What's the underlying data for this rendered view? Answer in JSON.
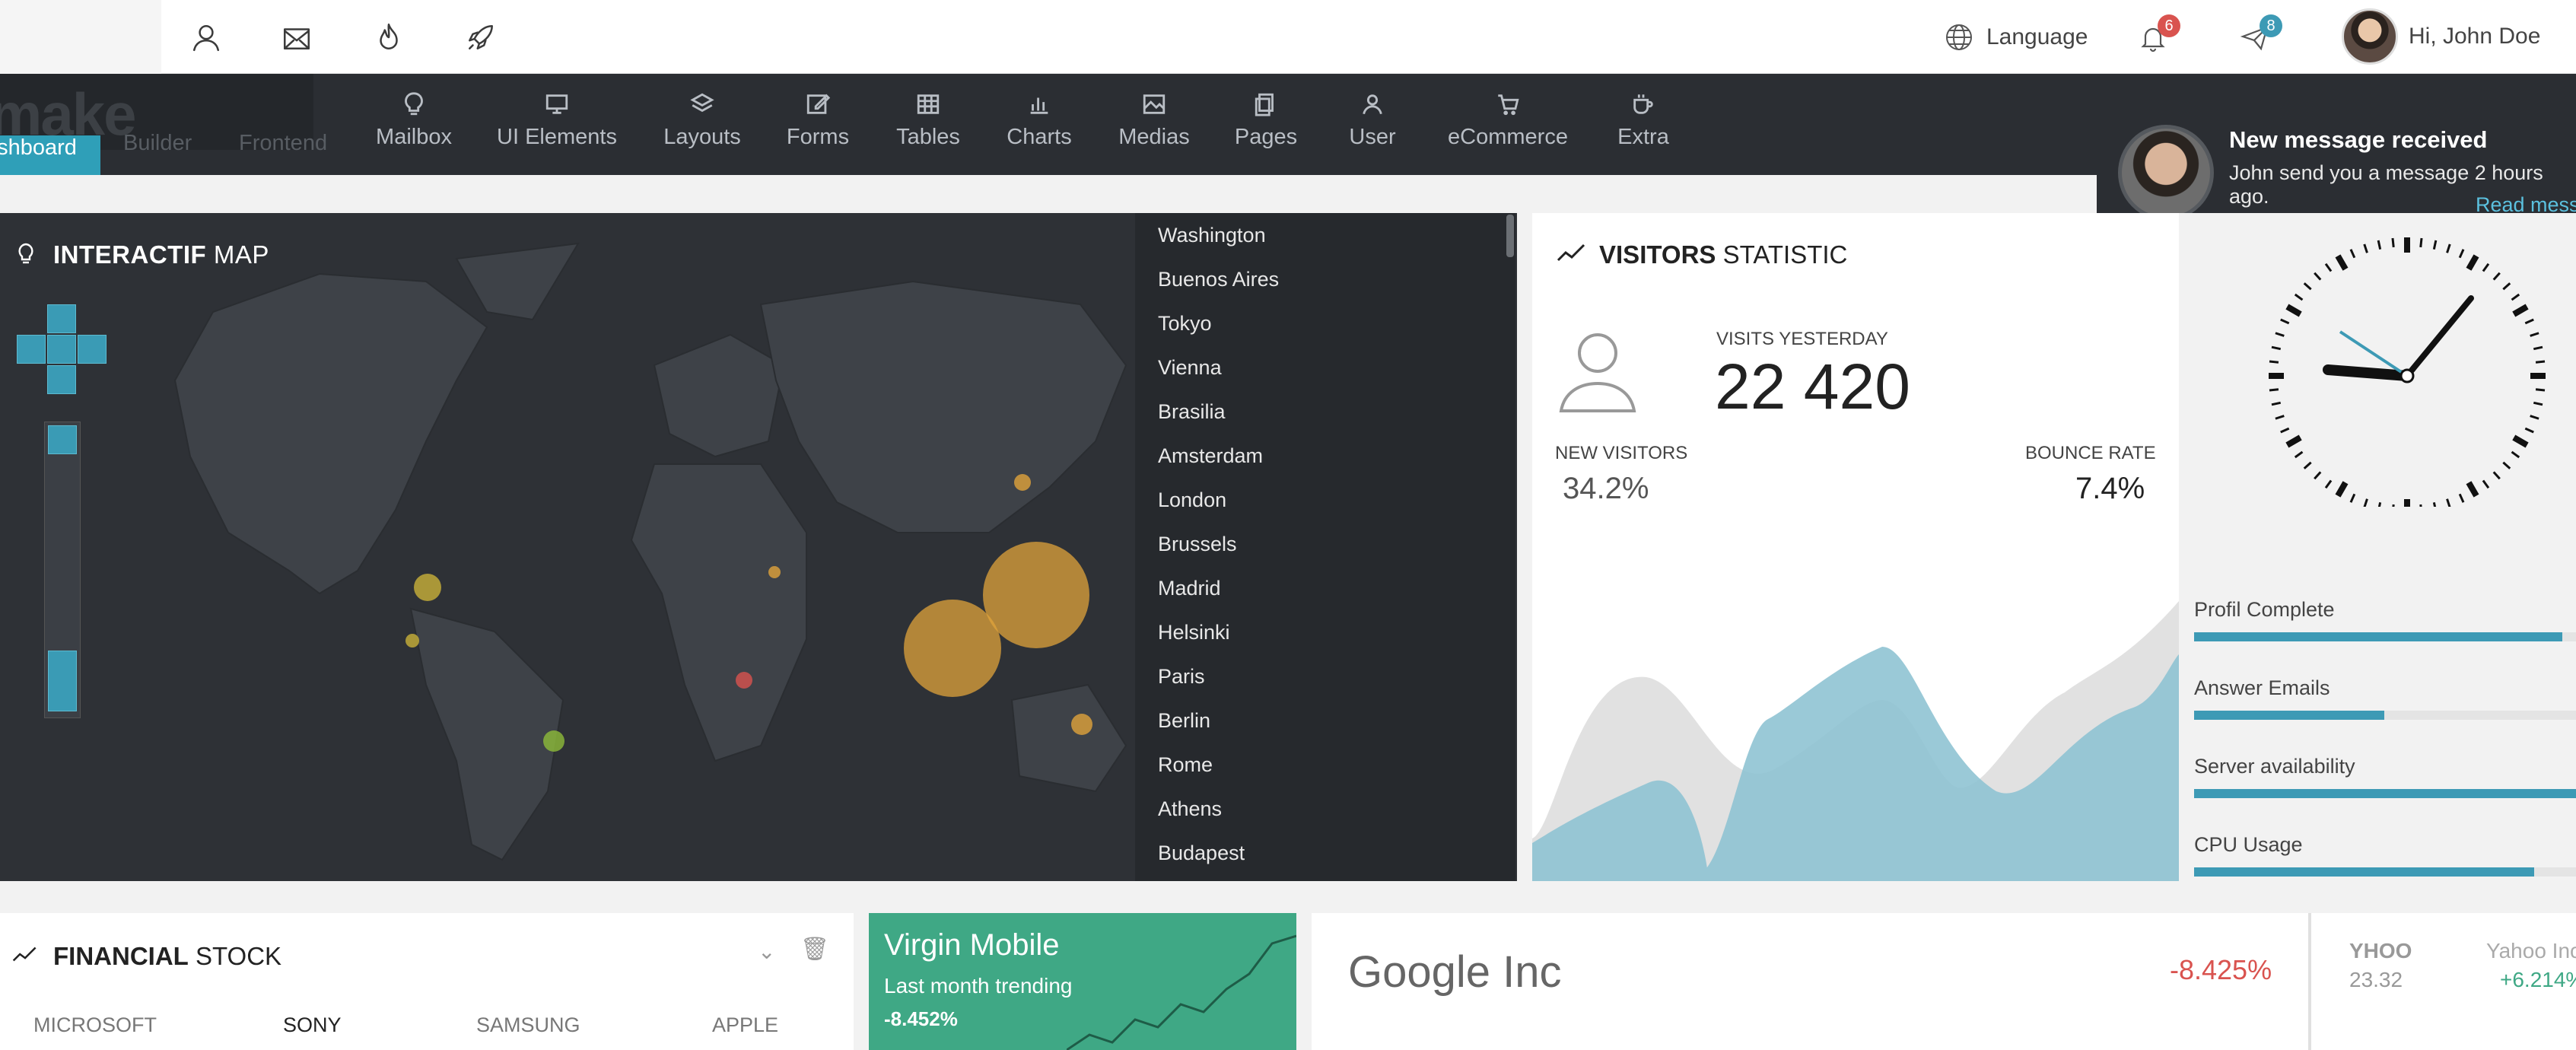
{
  "topbar": {
    "language_label": "Language",
    "notifications_count": "6",
    "messages_count": "8",
    "greeting": "Hi, John Doe",
    "colors": {
      "notif_badge": "#d9534f",
      "msg_badge": "#3d9ab5"
    }
  },
  "brand": {
    "text": "make"
  },
  "nav": {
    "ghost_items": [
      "ashboard",
      "Builder",
      "Frontend"
    ],
    "items": [
      {
        "label": "Mailbox",
        "icon": "bulb-icon"
      },
      {
        "label": "UI Elements",
        "icon": "monitor-icon"
      },
      {
        "label": "Layouts",
        "icon": "layers-icon"
      },
      {
        "label": "Forms",
        "icon": "edit-icon"
      },
      {
        "label": "Tables",
        "icon": "table-icon"
      },
      {
        "label": "Charts",
        "icon": "bar-chart-icon"
      },
      {
        "label": "Medias",
        "icon": "image-icon"
      },
      {
        "label": "Pages",
        "icon": "pages-icon"
      },
      {
        "label": "User",
        "icon": "user-icon"
      },
      {
        "label": "eCommerce",
        "icon": "cart-icon"
      },
      {
        "label": "Extra",
        "icon": "cup-icon"
      }
    ]
  },
  "toast": {
    "title": "New message received",
    "body": "John send you a message 2 hours ago.",
    "link": "Read mess"
  },
  "map_panel": {
    "title_bold": "INTERACTIF",
    "title_rest": " MAP",
    "cities": [
      "Washington",
      "Buenos Aires",
      "Tokyo",
      "Vienna",
      "Brasilia",
      "Amsterdam",
      "London",
      "Brussels",
      "Madrid",
      "Helsinki",
      "Paris",
      "Berlin",
      "Rome",
      "Athens",
      "Budapest"
    ]
  },
  "visitors": {
    "title_bold": "VISITORS",
    "title_rest": " STATISTIC",
    "visits_label": "VISITS YESTERDAY",
    "visits_value": "22 420",
    "new_label": "NEW VISITORS",
    "new_value": "34.2%",
    "bounce_label": "BOUNCE RATE",
    "bounce_value": "7.4%"
  },
  "progress": [
    {
      "label": "Profil Complete",
      "value": 0.93
    },
    {
      "label": "Answer Emails",
      "value": 0.48
    },
    {
      "label": "Server availability",
      "value": 1.0
    },
    {
      "label": "CPU Usage",
      "value": 0.86
    }
  ],
  "financial": {
    "title_bold": "FINANCIAL",
    "title_rest": " STOCK",
    "stocks": [
      "MICROSOFT",
      "SONY",
      "SAMSUNG",
      "APPLE"
    ]
  },
  "virgin": {
    "name": "Virgin Mobile",
    "sub": "Last month trending",
    "change": "-8.452%"
  },
  "google": {
    "name": "Google Inc",
    "change": "-8.425%"
  },
  "yahoo": {
    "ticker": "YHOO",
    "price": "23.32",
    "name": "Yahoo Inc",
    "change": "+6.214%"
  }
}
